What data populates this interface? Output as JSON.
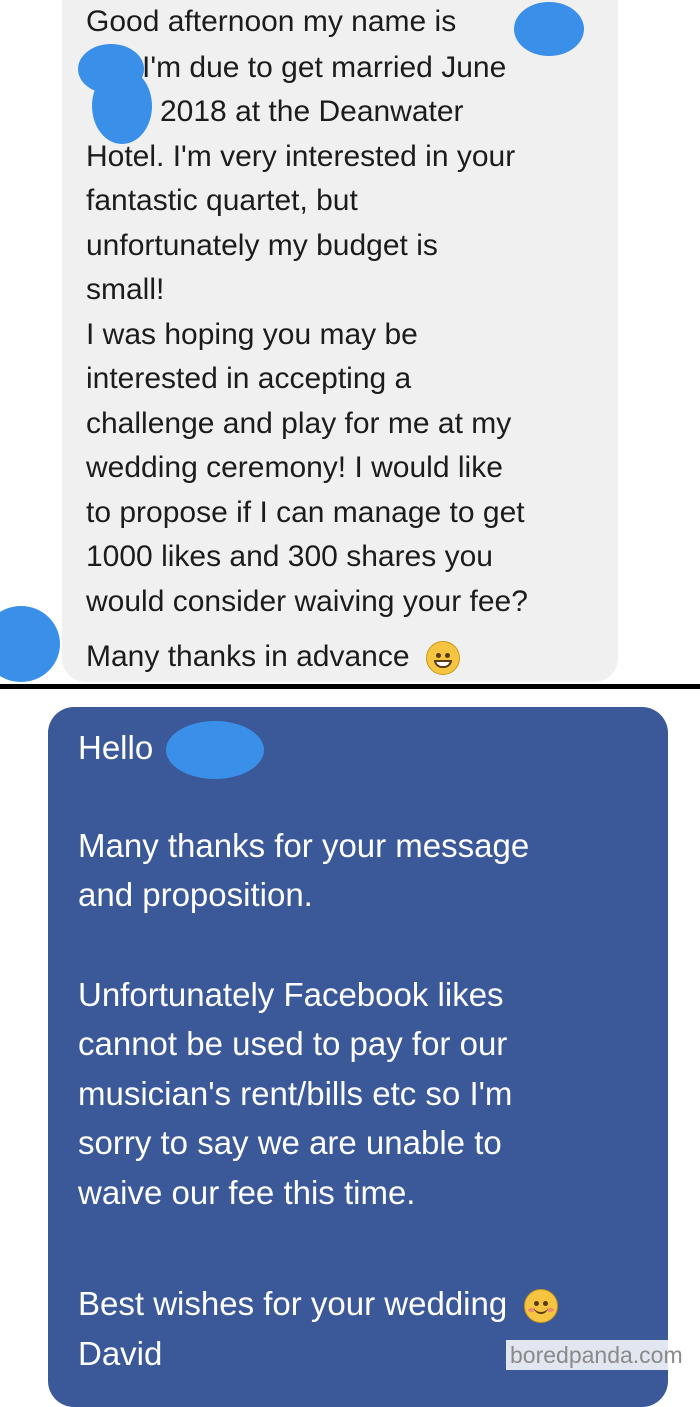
{
  "incoming_message": {
    "lines": [
      "Good afternoon my name is",
      "I'm due to get married June",
      "2018 at the Deanwater",
      "Hotel. I'm very interested in your",
      "fantastic quartet, but",
      "unfortunately my budget is",
      "small!",
      "I was hoping you may be",
      "interested in accepting a",
      "challenge and play for me at my",
      "wedding ceremony! I would like",
      "to propose if I can manage to get",
      "1000 likes and 300 shares you",
      "would consider waiving your fee?",
      "Many thanks in advance"
    ],
    "emoji": "grinning-face-icon"
  },
  "reply_message": {
    "lines": [
      "Hello",
      "Many thanks for your message",
      "and proposition.",
      "Unfortunately Facebook likes",
      "cannot be used to pay for our",
      "musician's rent/bills etc so I'm",
      "sorry to say we are unable to",
      "waive our fee this time.",
      "Best wishes for your wedding",
      "David"
    ],
    "emoji": "smiling-face-icon"
  },
  "watermark": "boredpanda.com",
  "colors": {
    "incoming_bubble": "#f0f0f0",
    "reply_bubble": "#3b5998",
    "redaction": "#3a8fe8"
  }
}
